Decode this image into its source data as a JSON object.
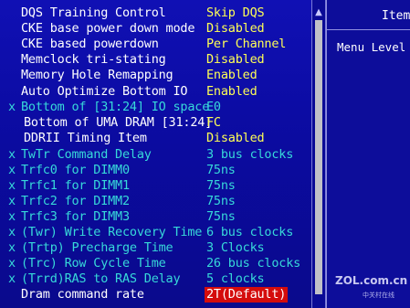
{
  "settings": [
    {
      "mark": "",
      "label": "DQS Training Control",
      "value": "Skip DQS",
      "disabled": false
    },
    {
      "mark": "",
      "label": "CKE base power down mode",
      "value": "Disabled",
      "disabled": false
    },
    {
      "mark": "",
      "label": "CKE based powerdown",
      "value": "Per Channel",
      "disabled": false
    },
    {
      "mark": "",
      "label": "Memclock tri-stating",
      "value": "Disabled",
      "disabled": false
    },
    {
      "mark": "",
      "label": "Memory Hole Remapping",
      "value": "Enabled",
      "disabled": false
    },
    {
      "mark": "",
      "label": "Auto Optimize Bottom IO",
      "value": "Enabled",
      "disabled": false
    },
    {
      "mark": "x",
      "label": "Bottom of [31:24] IO space",
      "value": "E0",
      "disabled": true
    },
    {
      "mark": "",
      "label": "Bottom of UMA DRAM [31:24]",
      "value": "FC",
      "disabled": false
    },
    {
      "mark": "",
      "label": "DDRII Timing Item",
      "value": "Disabled",
      "disabled": false
    },
    {
      "mark": "x",
      "label": "TwTr Command Delay",
      "value": "3 bus clocks",
      "disabled": true
    },
    {
      "mark": "x",
      "label": "Trfc0 for DIMM0",
      "value": "75ns",
      "disabled": true
    },
    {
      "mark": "x",
      "label": "Trfc1 for DIMM1",
      "value": "75ns",
      "disabled": true
    },
    {
      "mark": "x",
      "label": "Trfc2 for DIMM2",
      "value": "75ns",
      "disabled": true
    },
    {
      "mark": "x",
      "label": "Trfc3 for DIMM3",
      "value": "75ns",
      "disabled": true
    },
    {
      "mark": "x",
      "label": "(Twr) Write Recovery Time",
      "value": "6 bus clocks",
      "disabled": true
    },
    {
      "mark": "x",
      "label": "(Trtp) Precharge Time",
      "value": "3 Clocks",
      "disabled": true
    },
    {
      "mark": "x",
      "label": "(Trc) Row Cycle Time",
      "value": "26 bus clocks",
      "disabled": true
    },
    {
      "mark": "x",
      "label": "(Trrd)RAS to RAS Delay",
      "value": "5 clocks",
      "disabled": true
    },
    {
      "mark": "",
      "label": "Dram command rate",
      "value": "2T(Default)",
      "disabled": false,
      "selected": true
    }
  ],
  "help": {
    "title": "Item",
    "menu_level": "Menu Level"
  },
  "scrollbar": {
    "up_icon": "arrow-up-icon"
  },
  "watermark": {
    "site": "ZOL.com.cn",
    "cn": "中关村在线"
  },
  "colors": {
    "background": "#0c0ca6",
    "label": "#ffffff",
    "value": "#ffff55",
    "disabled": "#37d9d9",
    "selected_bg": "#d40c0c"
  }
}
